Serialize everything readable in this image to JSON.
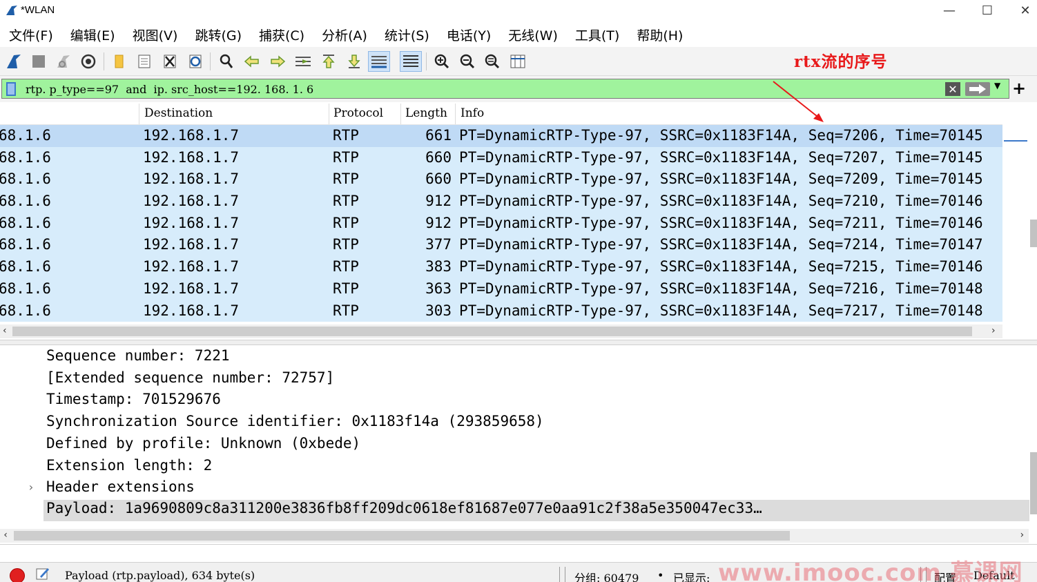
{
  "window": {
    "title": "*WLAN",
    "minimize_glyph": "—",
    "maximize_glyph": "☐",
    "close_glyph": "✕"
  },
  "menu": [
    "文件(F)",
    "编辑(E)",
    "视图(V)",
    "跳转(G)",
    "捕获(C)",
    "分析(A)",
    "统计(S)",
    "电话(Y)",
    "无线(W)",
    "工具(T)",
    "帮助(H)"
  ],
  "toolbar": {
    "icons": [
      "start-capture-icon",
      "stop-capture-icon",
      "restart-capture-icon",
      "capture-options-icon",
      "open-file-icon",
      "save-file-icon",
      "close-file-icon",
      "reload-file-icon",
      "find-packet-icon",
      "go-back-icon",
      "go-forward-icon",
      "go-to-packet-icon",
      "first-packet-icon",
      "last-packet-icon",
      "auto-scroll-icon",
      "colorize-icon",
      "zoom-in-icon",
      "zoom-out-icon",
      "normal-size-icon",
      "resize-columns-icon"
    ],
    "annotation": "rtx流的序号"
  },
  "filter": {
    "value": "rtp. p_type==97  and  ip. src_host==192. 168. 1. 6",
    "clear_glyph": "✕",
    "dropdown_glyph": "▼",
    "plus_glyph": "+"
  },
  "packet_list": {
    "columns": [
      "Destination",
      "Protocol",
      "Length",
      "Info"
    ],
    "rows": [
      {
        "src": "68.1.6",
        "dst": "192.168.1.7",
        "proto": "RTP",
        "len": "661",
        "info": "PT=DynamicRTP-Type-97, SSRC=0x1183F14A, Seq=7206, Time=70145"
      },
      {
        "src": "68.1.6",
        "dst": "192.168.1.7",
        "proto": "RTP",
        "len": "660",
        "info": "PT=DynamicRTP-Type-97, SSRC=0x1183F14A, Seq=7207, Time=70145"
      },
      {
        "src": "68.1.6",
        "dst": "192.168.1.7",
        "proto": "RTP",
        "len": "660",
        "info": "PT=DynamicRTP-Type-97, SSRC=0x1183F14A, Seq=7209, Time=70145"
      },
      {
        "src": "68.1.6",
        "dst": "192.168.1.7",
        "proto": "RTP",
        "len": "912",
        "info": "PT=DynamicRTP-Type-97, SSRC=0x1183F14A, Seq=7210, Time=70146"
      },
      {
        "src": "68.1.6",
        "dst": "192.168.1.7",
        "proto": "RTP",
        "len": "912",
        "info": "PT=DynamicRTP-Type-97, SSRC=0x1183F14A, Seq=7211, Time=70146"
      },
      {
        "src": "68.1.6",
        "dst": "192.168.1.7",
        "proto": "RTP",
        "len": "377",
        "info": "PT=DynamicRTP-Type-97, SSRC=0x1183F14A, Seq=7214, Time=70147"
      },
      {
        "src": "68.1.6",
        "dst": "192.168.1.7",
        "proto": "RTP",
        "len": "383",
        "info": "PT=DynamicRTP-Type-97, SSRC=0x1183F14A, Seq=7215, Time=70146"
      },
      {
        "src": "68.1.6",
        "dst": "192.168.1.7",
        "proto": "RTP",
        "len": "363",
        "info": "PT=DynamicRTP-Type-97, SSRC=0x1183F14A, Seq=7216, Time=70148"
      },
      {
        "src": "68.1.6",
        "dst": "192.168.1.7",
        "proto": "RTP",
        "len": "303",
        "info": "PT=DynamicRTP-Type-97, SSRC=0x1183F14A, Seq=7217, Time=70148"
      }
    ]
  },
  "details": {
    "lines": [
      "Sequence number: 7221",
      "[Extended sequence number: 72757]",
      "Timestamp: 701529676",
      "Synchronization Source identifier: 0x1183f14a (293859658)",
      "Defined by profile: Unknown (0xbede)",
      "Extension length: 2",
      "Header extensions"
    ],
    "payload": "Payload: 1a9690809c8a311200e3836fb8ff209dc0618ef81687e077e0aa91c2f38a5e350047ec33…",
    "expander_glyph": "›"
  },
  "status": {
    "field_text": "Payload (rtp.payload), 634 byte(s)",
    "packets_label": "分组: 60479",
    "bullet": "•",
    "displayed_label": "已显示: ",
    "profile_label": "配置",
    "profile_value": "Default"
  },
  "watermark": "www.imooc.com 慕课网",
  "colors": {
    "filter_valid_bg": "#a0f39d",
    "row_bg": "#d7ecfb",
    "selected_row_bg": "#bfdaf5",
    "annotation_red": "#e8191a"
  }
}
